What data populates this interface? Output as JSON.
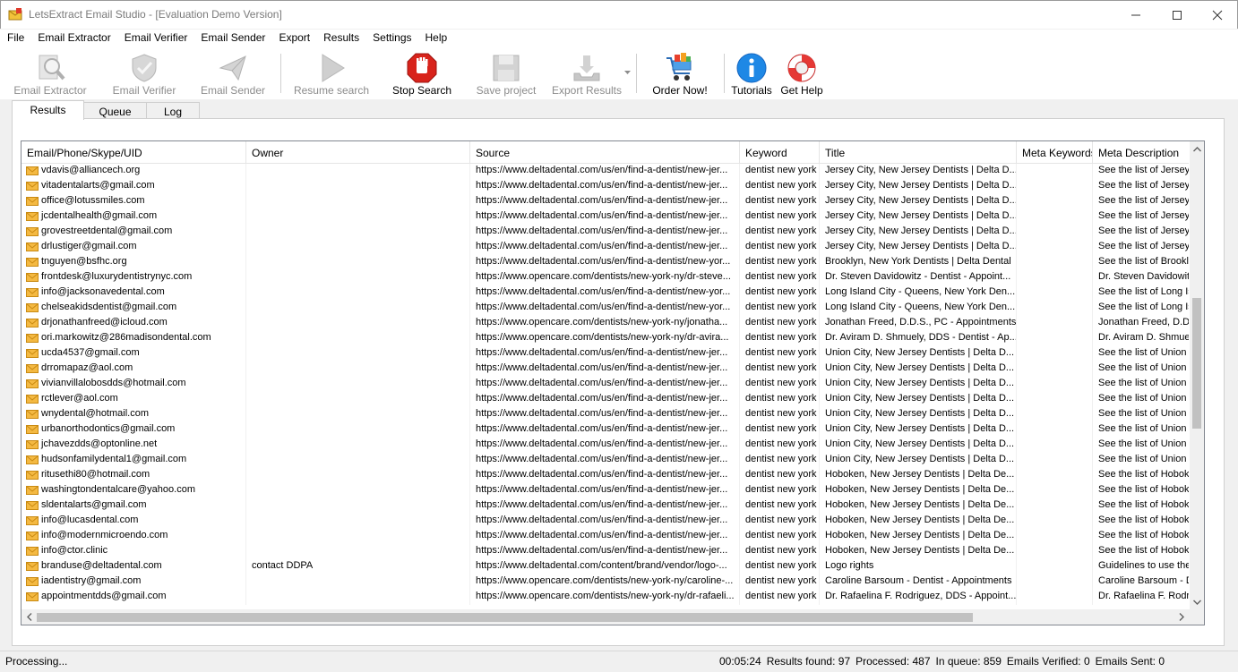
{
  "window": {
    "title": "LetsExtract Email Studio - [Evaluation Demo Version]"
  },
  "menu": [
    "File",
    "Email Extractor",
    "Email Verifier",
    "Email Sender",
    "Export",
    "Results",
    "Settings",
    "Help"
  ],
  "toolbar": {
    "email_extractor": "Email Extractor",
    "email_verifier": "Email Verifier",
    "email_sender": "Email Sender",
    "resume_search": "Resume search",
    "stop_search": "Stop Search",
    "save_project": "Save project",
    "export_results": "Export Results",
    "order_now": "Order Now!",
    "tutorials": "Tutorials",
    "get_help": "Get Help"
  },
  "tabs": [
    "Results",
    "Queue",
    "Log"
  ],
  "grid": {
    "columns": [
      "Email/Phone/Skype/UID",
      "Owner",
      "Source",
      "Keyword",
      "Title",
      "Meta Keywords",
      "Meta Description"
    ],
    "rows": [
      [
        "vdavis@alliancech.org",
        "",
        "https://www.deltadental.com/us/en/find-a-dentist/new-jer...",
        "dentist new york",
        "Jersey City, New Jersey Dentists | Delta D...",
        "",
        "See the list of Jersey C"
      ],
      [
        "vitadentalarts@gmail.com",
        "",
        "https://www.deltadental.com/us/en/find-a-dentist/new-jer...",
        "dentist new york",
        "Jersey City, New Jersey Dentists | Delta D...",
        "",
        "See the list of Jersey C"
      ],
      [
        "office@lotussmiles.com",
        "",
        "https://www.deltadental.com/us/en/find-a-dentist/new-jer...",
        "dentist new york",
        "Jersey City, New Jersey Dentists | Delta D...",
        "",
        "See the list of Jersey C"
      ],
      [
        "jcdentalhealth@gmail.com",
        "",
        "https://www.deltadental.com/us/en/find-a-dentist/new-jer...",
        "dentist new york",
        "Jersey City, New Jersey Dentists | Delta D...",
        "",
        "See the list of Jersey C"
      ],
      [
        "grovestreetdental@gmail.com",
        "",
        "https://www.deltadental.com/us/en/find-a-dentist/new-jer...",
        "dentist new york",
        "Jersey City, New Jersey Dentists | Delta D...",
        "",
        "See the list of Jersey C"
      ],
      [
        "drlustiger@gmail.com",
        "",
        "https://www.deltadental.com/us/en/find-a-dentist/new-jer...",
        "dentist new york",
        "Jersey City, New Jersey Dentists | Delta D...",
        "",
        "See the list of Jersey C"
      ],
      [
        "tnguyen@bsfhc.org",
        "",
        "https://www.deltadental.com/us/en/find-a-dentist/new-yor...",
        "dentist new york",
        "Brooklyn, New York Dentists | Delta Dental",
        "",
        "See the list of Brookly"
      ],
      [
        "frontdesk@luxurydentistrynyc.com",
        "",
        "https://www.opencare.com/dentists/new-york-ny/dr-steve...",
        "dentist new york",
        "Dr. Steven Davidowitz - Dentist - Appoint...",
        "",
        "Dr. Steven Davidowit"
      ],
      [
        "info@jacksonavedental.com",
        "",
        "https://www.deltadental.com/us/en/find-a-dentist/new-yor...",
        "dentist new york",
        "Long Island City - Queens, New York Den...",
        "",
        "See the list of Long Is"
      ],
      [
        "chelseakidsdentist@gmail.com",
        "",
        "https://www.deltadental.com/us/en/find-a-dentist/new-yor...",
        "dentist new york",
        "Long Island City - Queens, New York Den...",
        "",
        "See the list of Long Is"
      ],
      [
        "drjonathanfreed@icloud.com",
        "",
        "https://www.opencare.com/dentists/new-york-ny/jonatha...",
        "dentist new york",
        "Jonathan Freed, D.D.S., PC - Appointments",
        "",
        "Jonathan Freed, D.D."
      ],
      [
        "ori.markowitz@286madisondental.com",
        "",
        "https://www.opencare.com/dentists/new-york-ny/dr-avira...",
        "dentist new york",
        "Dr. Aviram D. Shmuely, DDS - Dentist - Ap...",
        "",
        "Dr. Aviram D. Shmuel"
      ],
      [
        "ucda4537@gmail.com",
        "",
        "https://www.deltadental.com/us/en/find-a-dentist/new-jer...",
        "dentist new york",
        "Union City, New Jersey Dentists | Delta D...",
        "",
        "See the list of Union C"
      ],
      [
        "drromapaz@aol.com",
        "",
        "https://www.deltadental.com/us/en/find-a-dentist/new-jer...",
        "dentist new york",
        "Union City, New Jersey Dentists | Delta D...",
        "",
        "See the list of Union C"
      ],
      [
        "vivianvillalobosdds@hotmail.com",
        "",
        "https://www.deltadental.com/us/en/find-a-dentist/new-jer...",
        "dentist new york",
        "Union City, New Jersey Dentists | Delta D...",
        "",
        "See the list of Union C"
      ],
      [
        "rctlever@aol.com",
        "",
        "https://www.deltadental.com/us/en/find-a-dentist/new-jer...",
        "dentist new york",
        "Union City, New Jersey Dentists | Delta D...",
        "",
        "See the list of Union C"
      ],
      [
        "wnydental@hotmail.com",
        "",
        "https://www.deltadental.com/us/en/find-a-dentist/new-jer...",
        "dentist new york",
        "Union City, New Jersey Dentists | Delta D...",
        "",
        "See the list of Union C"
      ],
      [
        "urbanorthodontics@gmail.com",
        "",
        "https://www.deltadental.com/us/en/find-a-dentist/new-jer...",
        "dentist new york",
        "Union City, New Jersey Dentists | Delta D...",
        "",
        "See the list of Union C"
      ],
      [
        "jchavezdds@optonline.net",
        "",
        "https://www.deltadental.com/us/en/find-a-dentist/new-jer...",
        "dentist new york",
        "Union City, New Jersey Dentists | Delta D...",
        "",
        "See the list of Union C"
      ],
      [
        "hudsonfamilydental1@gmail.com",
        "",
        "https://www.deltadental.com/us/en/find-a-dentist/new-jer...",
        "dentist new york",
        "Union City, New Jersey Dentists | Delta D...",
        "",
        "See the list of Union C"
      ],
      [
        "ritusethi80@hotmail.com",
        "",
        "https://www.deltadental.com/us/en/find-a-dentist/new-jer...",
        "dentist new york",
        "Hoboken, New Jersey Dentists | Delta De...",
        "",
        "See the list of Hoboke"
      ],
      [
        "washingtondentalcare@yahoo.com",
        "",
        "https://www.deltadental.com/us/en/find-a-dentist/new-jer...",
        "dentist new york",
        "Hoboken, New Jersey Dentists | Delta De...",
        "",
        "See the list of Hoboke"
      ],
      [
        "sldentalarts@gmail.com",
        "",
        "https://www.deltadental.com/us/en/find-a-dentist/new-jer...",
        "dentist new york",
        "Hoboken, New Jersey Dentists | Delta De...",
        "",
        "See the list of Hoboke"
      ],
      [
        "info@lucasdental.com",
        "",
        "https://www.deltadental.com/us/en/find-a-dentist/new-jer...",
        "dentist new york",
        "Hoboken, New Jersey Dentists | Delta De...",
        "",
        "See the list of Hoboke"
      ],
      [
        "info@modernmicroendo.com",
        "",
        "https://www.deltadental.com/us/en/find-a-dentist/new-jer...",
        "dentist new york",
        "Hoboken, New Jersey Dentists | Delta De...",
        "",
        "See the list of Hoboke"
      ],
      [
        "info@ctor.clinic",
        "",
        "https://www.deltadental.com/us/en/find-a-dentist/new-jer...",
        "dentist new york",
        "Hoboken, New Jersey Dentists | Delta De...",
        "",
        "See the list of Hoboke"
      ],
      [
        "branduse@deltadental.com",
        "contact DDPA",
        "https://www.deltadental.com/content/brand/vendor/logo-...",
        "dentist new york",
        "Logo rights",
        "",
        "Guidelines to use the"
      ],
      [
        "iadentistry@gmail.com",
        "",
        "https://www.opencare.com/dentists/new-york-ny/caroline-...",
        "dentist new york",
        "Caroline Barsoum - Dentist - Appointments",
        "",
        "Caroline Barsoum - De"
      ],
      [
        "appointmentdds@gmail.com",
        "",
        "https://www.opencare.com/dentists/new-york-ny/dr-rafaeli...",
        "dentist new york",
        "Dr. Rafaelina F. Rodriguez, DDS - Appoint...",
        "",
        "Dr. Rafaelina F. Rodri"
      ]
    ]
  },
  "status": {
    "state": "Processing...",
    "elapsed": "00:05:24",
    "results_found": "Results found: 97",
    "processed": "Processed: 487",
    "in_queue": "In queue: 859",
    "emails_verified": "Emails Verified: 0",
    "emails_sent": "Emails Sent: 0"
  }
}
